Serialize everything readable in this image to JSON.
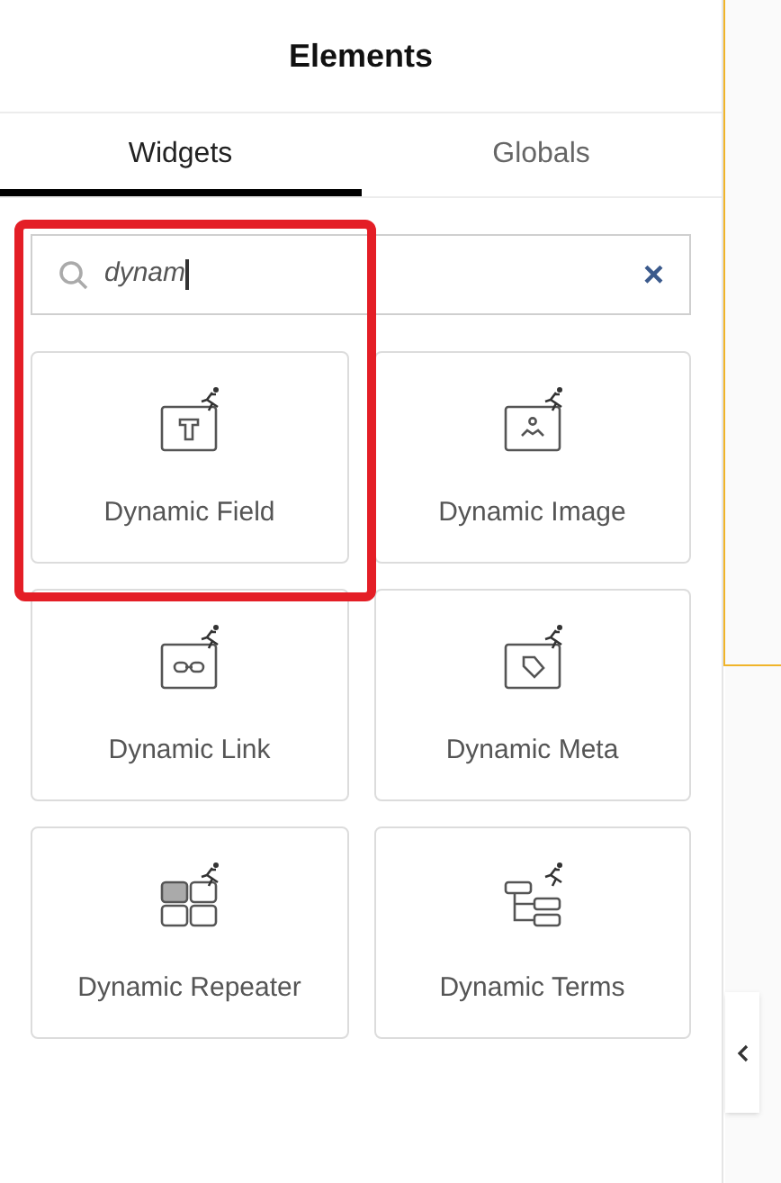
{
  "panel": {
    "title": "Elements"
  },
  "tabs": [
    {
      "label": "Widgets",
      "selected": true
    },
    {
      "label": "Globals",
      "selected": false
    }
  ],
  "search": {
    "value": "dynam",
    "clear": "×"
  },
  "widgets": [
    {
      "kind": "field",
      "label": "Dynamic Field"
    },
    {
      "kind": "image",
      "label": "Dynamic Image"
    },
    {
      "kind": "link",
      "label": "Dynamic Link"
    },
    {
      "kind": "meta",
      "label": "Dynamic Meta"
    },
    {
      "kind": "repeater",
      "label": "Dynamic Repeater"
    },
    {
      "kind": "terms",
      "label": "Dynamic Terms"
    }
  ],
  "highlight_box": true
}
